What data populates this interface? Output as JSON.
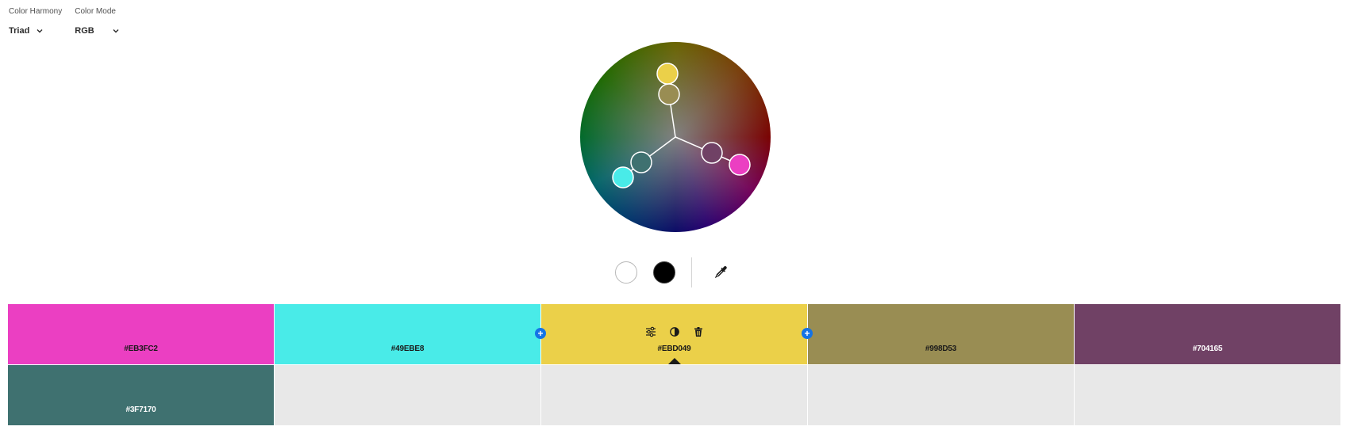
{
  "harmony": {
    "label": "Color Harmony",
    "value": "Triad"
  },
  "mode": {
    "label": "Color Mode",
    "value": "RGB"
  },
  "wheel": {
    "base_color": "#EBD049"
  },
  "tools": {
    "white_icon": "white-circle",
    "black_icon": "black-circle",
    "eyedropper_icon": "eyedropper"
  },
  "swatches": [
    {
      "hex": "#EB3FC2",
      "text_color": "#1a1a1a"
    },
    {
      "hex": "#49EBE8",
      "text_color": "#1a1a1a"
    },
    {
      "hex": "#EBD049",
      "text_color": "#1a1a1a",
      "active": true
    },
    {
      "hex": "#998D53",
      "text_color": "#1a1a1a"
    },
    {
      "hex": "#704165",
      "text_color": "#ffffff"
    },
    {
      "hex": "#3F7170",
      "text_color": "#ffffff"
    }
  ],
  "active_actions": [
    "sliders-icon",
    "contrast-icon",
    "trash-icon"
  ],
  "accent": "#1473E6"
}
